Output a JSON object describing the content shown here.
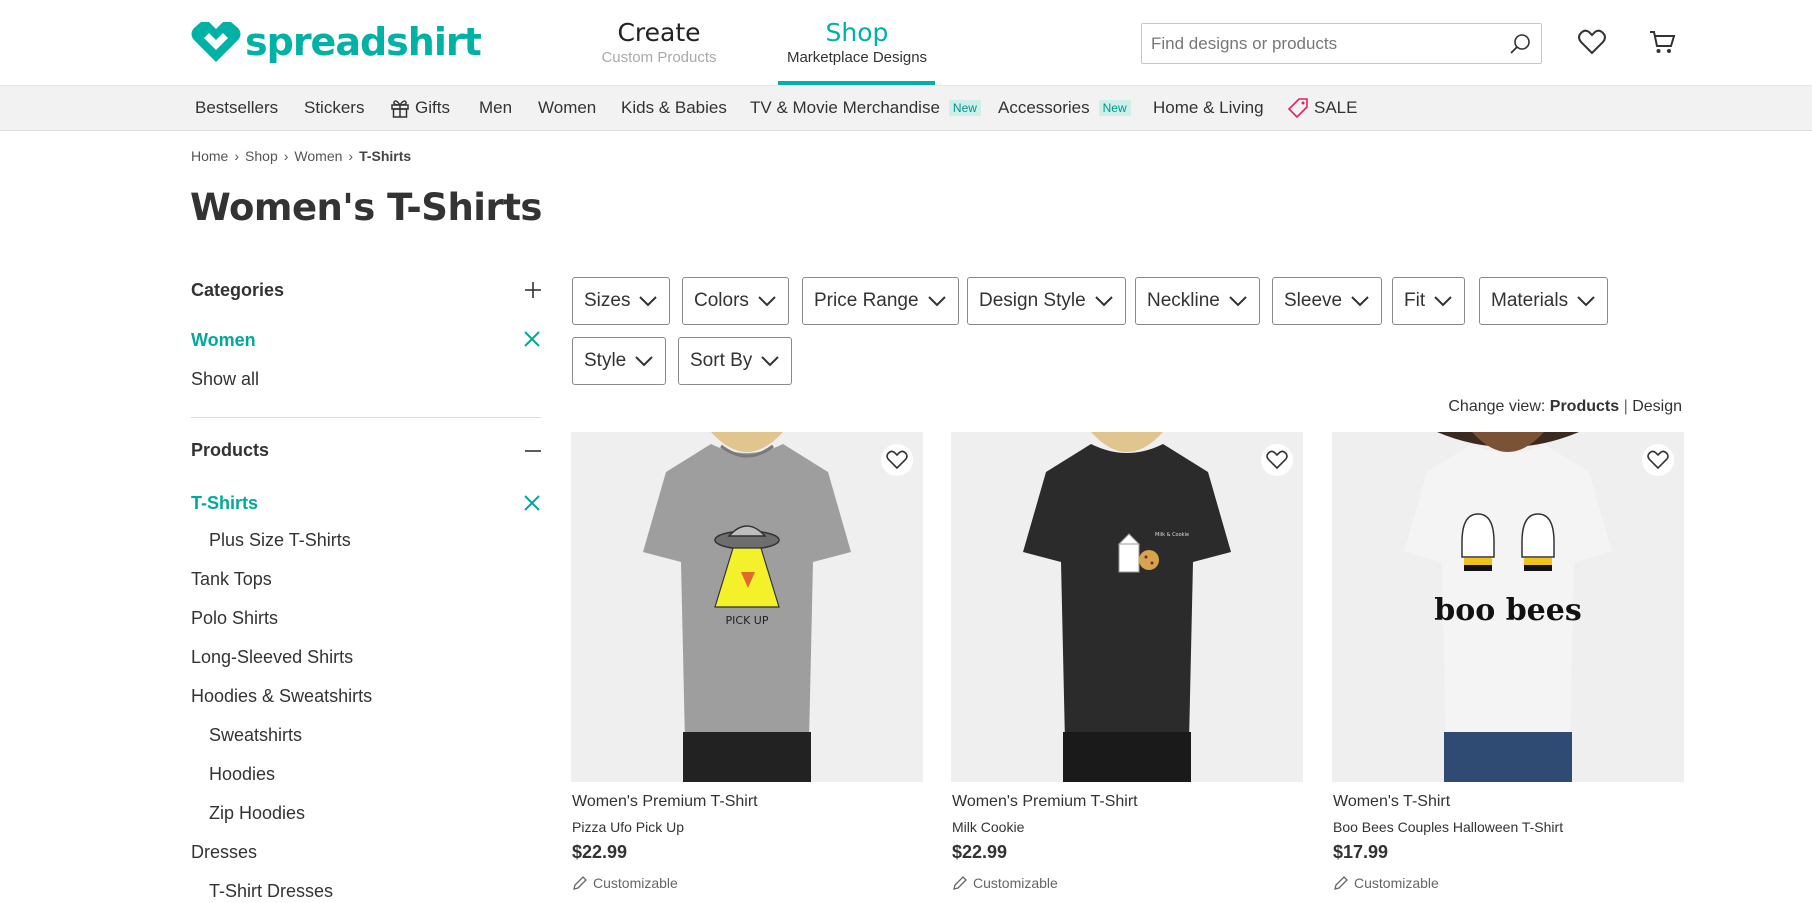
{
  "header": {
    "logo_text": "spreadshirt",
    "tabs": [
      {
        "title": "Create",
        "subtitle": "Custom Products"
      },
      {
        "title": "Shop",
        "subtitle": "Marketplace Designs"
      }
    ],
    "search_placeholder": "Find designs or products",
    "icons": [
      "search-icon",
      "heart-icon",
      "cart-icon"
    ],
    "accent_color": "#00b2a5"
  },
  "nav": {
    "items": [
      {
        "label": "Bestsellers"
      },
      {
        "label": "Stickers"
      },
      {
        "label": "Gifts",
        "icon": "gift-icon"
      },
      {
        "label": "Men"
      },
      {
        "label": "Women"
      },
      {
        "label": "Kids & Babies"
      },
      {
        "label": "TV & Movie Merchandise",
        "badge": "New"
      },
      {
        "label": "Accessories",
        "badge": "New"
      },
      {
        "label": "Home & Living"
      },
      {
        "label": "SALE",
        "icon": "tag-icon",
        "color": "#e0245e"
      }
    ]
  },
  "breadcrumb": [
    "Home",
    "Shop",
    "Women",
    "T-Shirts"
  ],
  "page_title": "Women's T-Shirts",
  "sidebar": {
    "categories": {
      "heading": "Categories",
      "selected": "Women",
      "show_all": "Show all"
    },
    "products": {
      "heading": "Products",
      "selected": "T-Shirts",
      "items": [
        "Plus Size T-Shirts",
        "Tank Tops",
        "Polo Shirts",
        "Long-Sleeved Shirts",
        "Hoodies & Sweatshirts",
        "Sweatshirts",
        "Hoodies",
        "Zip Hoodies",
        "Dresses",
        "T-Shirt Dresses"
      ]
    }
  },
  "filters": [
    "Sizes",
    "Colors",
    "Price Range",
    "Design Style",
    "Neckline",
    "Sleeve",
    "Fit",
    "Materials",
    "Style",
    "Sort By"
  ],
  "change_view": {
    "label": "Change view:",
    "options": [
      "Products",
      "Design"
    ],
    "separator": "|",
    "active": "Products"
  },
  "products": [
    {
      "type": "Women's Premium T-Shirt",
      "name": "Pizza Ufo Pick Up",
      "price": "$22.99",
      "customizable": "Customizable",
      "shirt_color": "#9e9e9e",
      "design_text": "PICK UP"
    },
    {
      "type": "Women's Premium T-Shirt",
      "name": "Milk Cookie",
      "price": "$22.99",
      "customizable": "Customizable",
      "shirt_color": "#2b2b2b",
      "design_text": "Milk & Cookie"
    },
    {
      "type": "Women's T-Shirt",
      "name": "Boo Bees Couples Halloween T-Shirt",
      "price": "$17.99",
      "customizable": "Customizable",
      "shirt_color": "#f1f1f1",
      "design_text": "boo bees"
    }
  ]
}
